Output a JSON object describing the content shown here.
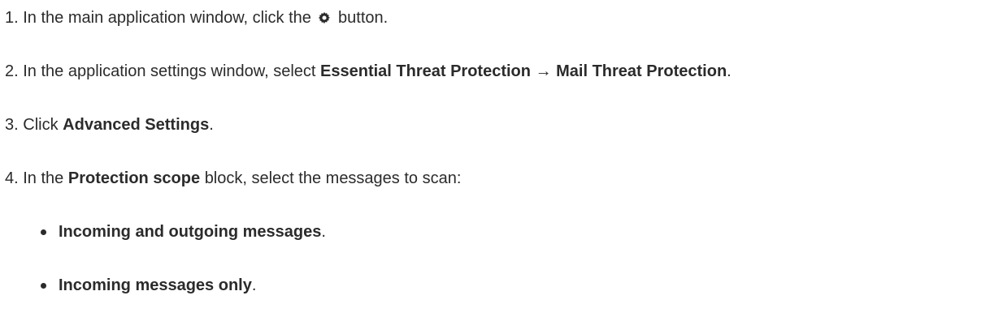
{
  "steps": [
    {
      "number": "1.",
      "pre": "In the main application window, click the",
      "icon": "gear-icon",
      "post": "button."
    },
    {
      "number": "2.",
      "pre": "In the application settings window, select",
      "bold1": "Essential Threat Protection",
      "arrow": "→",
      "bold2": "Mail Threat Protection",
      "post": "."
    },
    {
      "number": "3.",
      "pre": "Click",
      "bold": "Advanced Settings",
      "post": "."
    },
    {
      "number": "4.",
      "pre": "In the",
      "bold": "Protection scope",
      "post": "block, select the messages to scan:"
    }
  ],
  "options": [
    {
      "label": "Incoming and outgoing messages",
      "suffix": "."
    },
    {
      "label": "Incoming messages only",
      "suffix": "."
    }
  ]
}
